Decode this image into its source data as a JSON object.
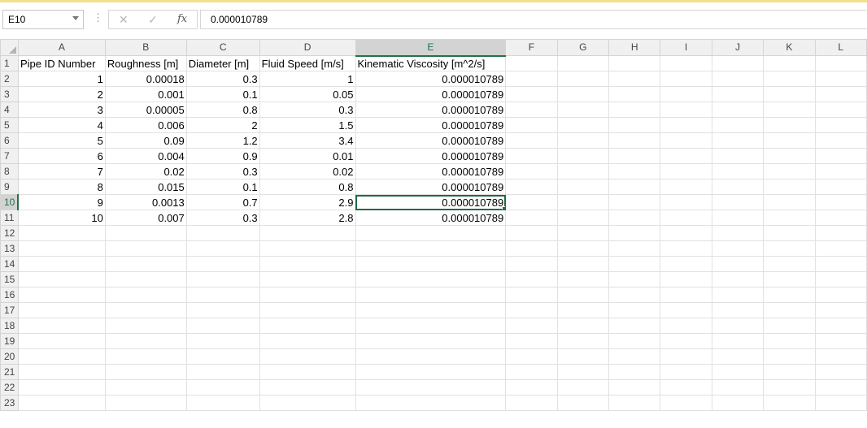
{
  "formula_bar": {
    "name_box": "E10",
    "cancel_icon": "close-icon",
    "enter_icon": "check-icon",
    "function_label": "fx",
    "formula_value": "0.000010789"
  },
  "columns": [
    "A",
    "B",
    "C",
    "D",
    "E",
    "F",
    "G",
    "H",
    "I",
    "J",
    "K",
    "L"
  ],
  "row_numbers": [
    "1",
    "2",
    "3",
    "4",
    "5",
    "6",
    "7",
    "8",
    "9",
    "10",
    "11",
    "12",
    "13",
    "14",
    "15",
    "16",
    "17",
    "18",
    "19",
    "20",
    "21",
    "22",
    "23"
  ],
  "rows": [
    [
      "Pipe ID Number",
      "Roughness [m]",
      "Diameter [m]",
      "Fluid Speed [m/s]",
      "Kinematic Viscosity  [m^2/s]",
      "",
      "",
      "",
      "",
      "",
      "",
      ""
    ],
    [
      "1",
      "0.00018",
      "0.3",
      "1",
      "0.000010789",
      "",
      "",
      "",
      "",
      "",
      "",
      ""
    ],
    [
      "2",
      "0.001",
      "0.1",
      "0.05",
      "0.000010789",
      "",
      "",
      "",
      "",
      "",
      "",
      ""
    ],
    [
      "3",
      "0.00005",
      "0.8",
      "0.3",
      "0.000010789",
      "",
      "",
      "",
      "",
      "",
      "",
      ""
    ],
    [
      "4",
      "0.006",
      "2",
      "1.5",
      "0.000010789",
      "",
      "",
      "",
      "",
      "",
      "",
      ""
    ],
    [
      "5",
      "0.09",
      "1.2",
      "3.4",
      "0.000010789",
      "",
      "",
      "",
      "",
      "",
      "",
      ""
    ],
    [
      "6",
      "0.004",
      "0.9",
      "0.01",
      "0.000010789",
      "",
      "",
      "",
      "",
      "",
      "",
      ""
    ],
    [
      "7",
      "0.02",
      "0.3",
      "0.02",
      "0.000010789",
      "",
      "",
      "",
      "",
      "",
      "",
      ""
    ],
    [
      "8",
      "0.015",
      "0.1",
      "0.8",
      "0.000010789",
      "",
      "",
      "",
      "",
      "",
      "",
      ""
    ],
    [
      "9",
      "0.0013",
      "0.7",
      "2.9",
      "0.000010789",
      "",
      "",
      "",
      "",
      "",
      "",
      ""
    ],
    [
      "10",
      "0.007",
      "0.3",
      "2.8",
      "0.000010789",
      "",
      "",
      "",
      "",
      "",
      "",
      ""
    ]
  ],
  "selection": {
    "active_cell": "E10",
    "accent_color": "#217346"
  }
}
